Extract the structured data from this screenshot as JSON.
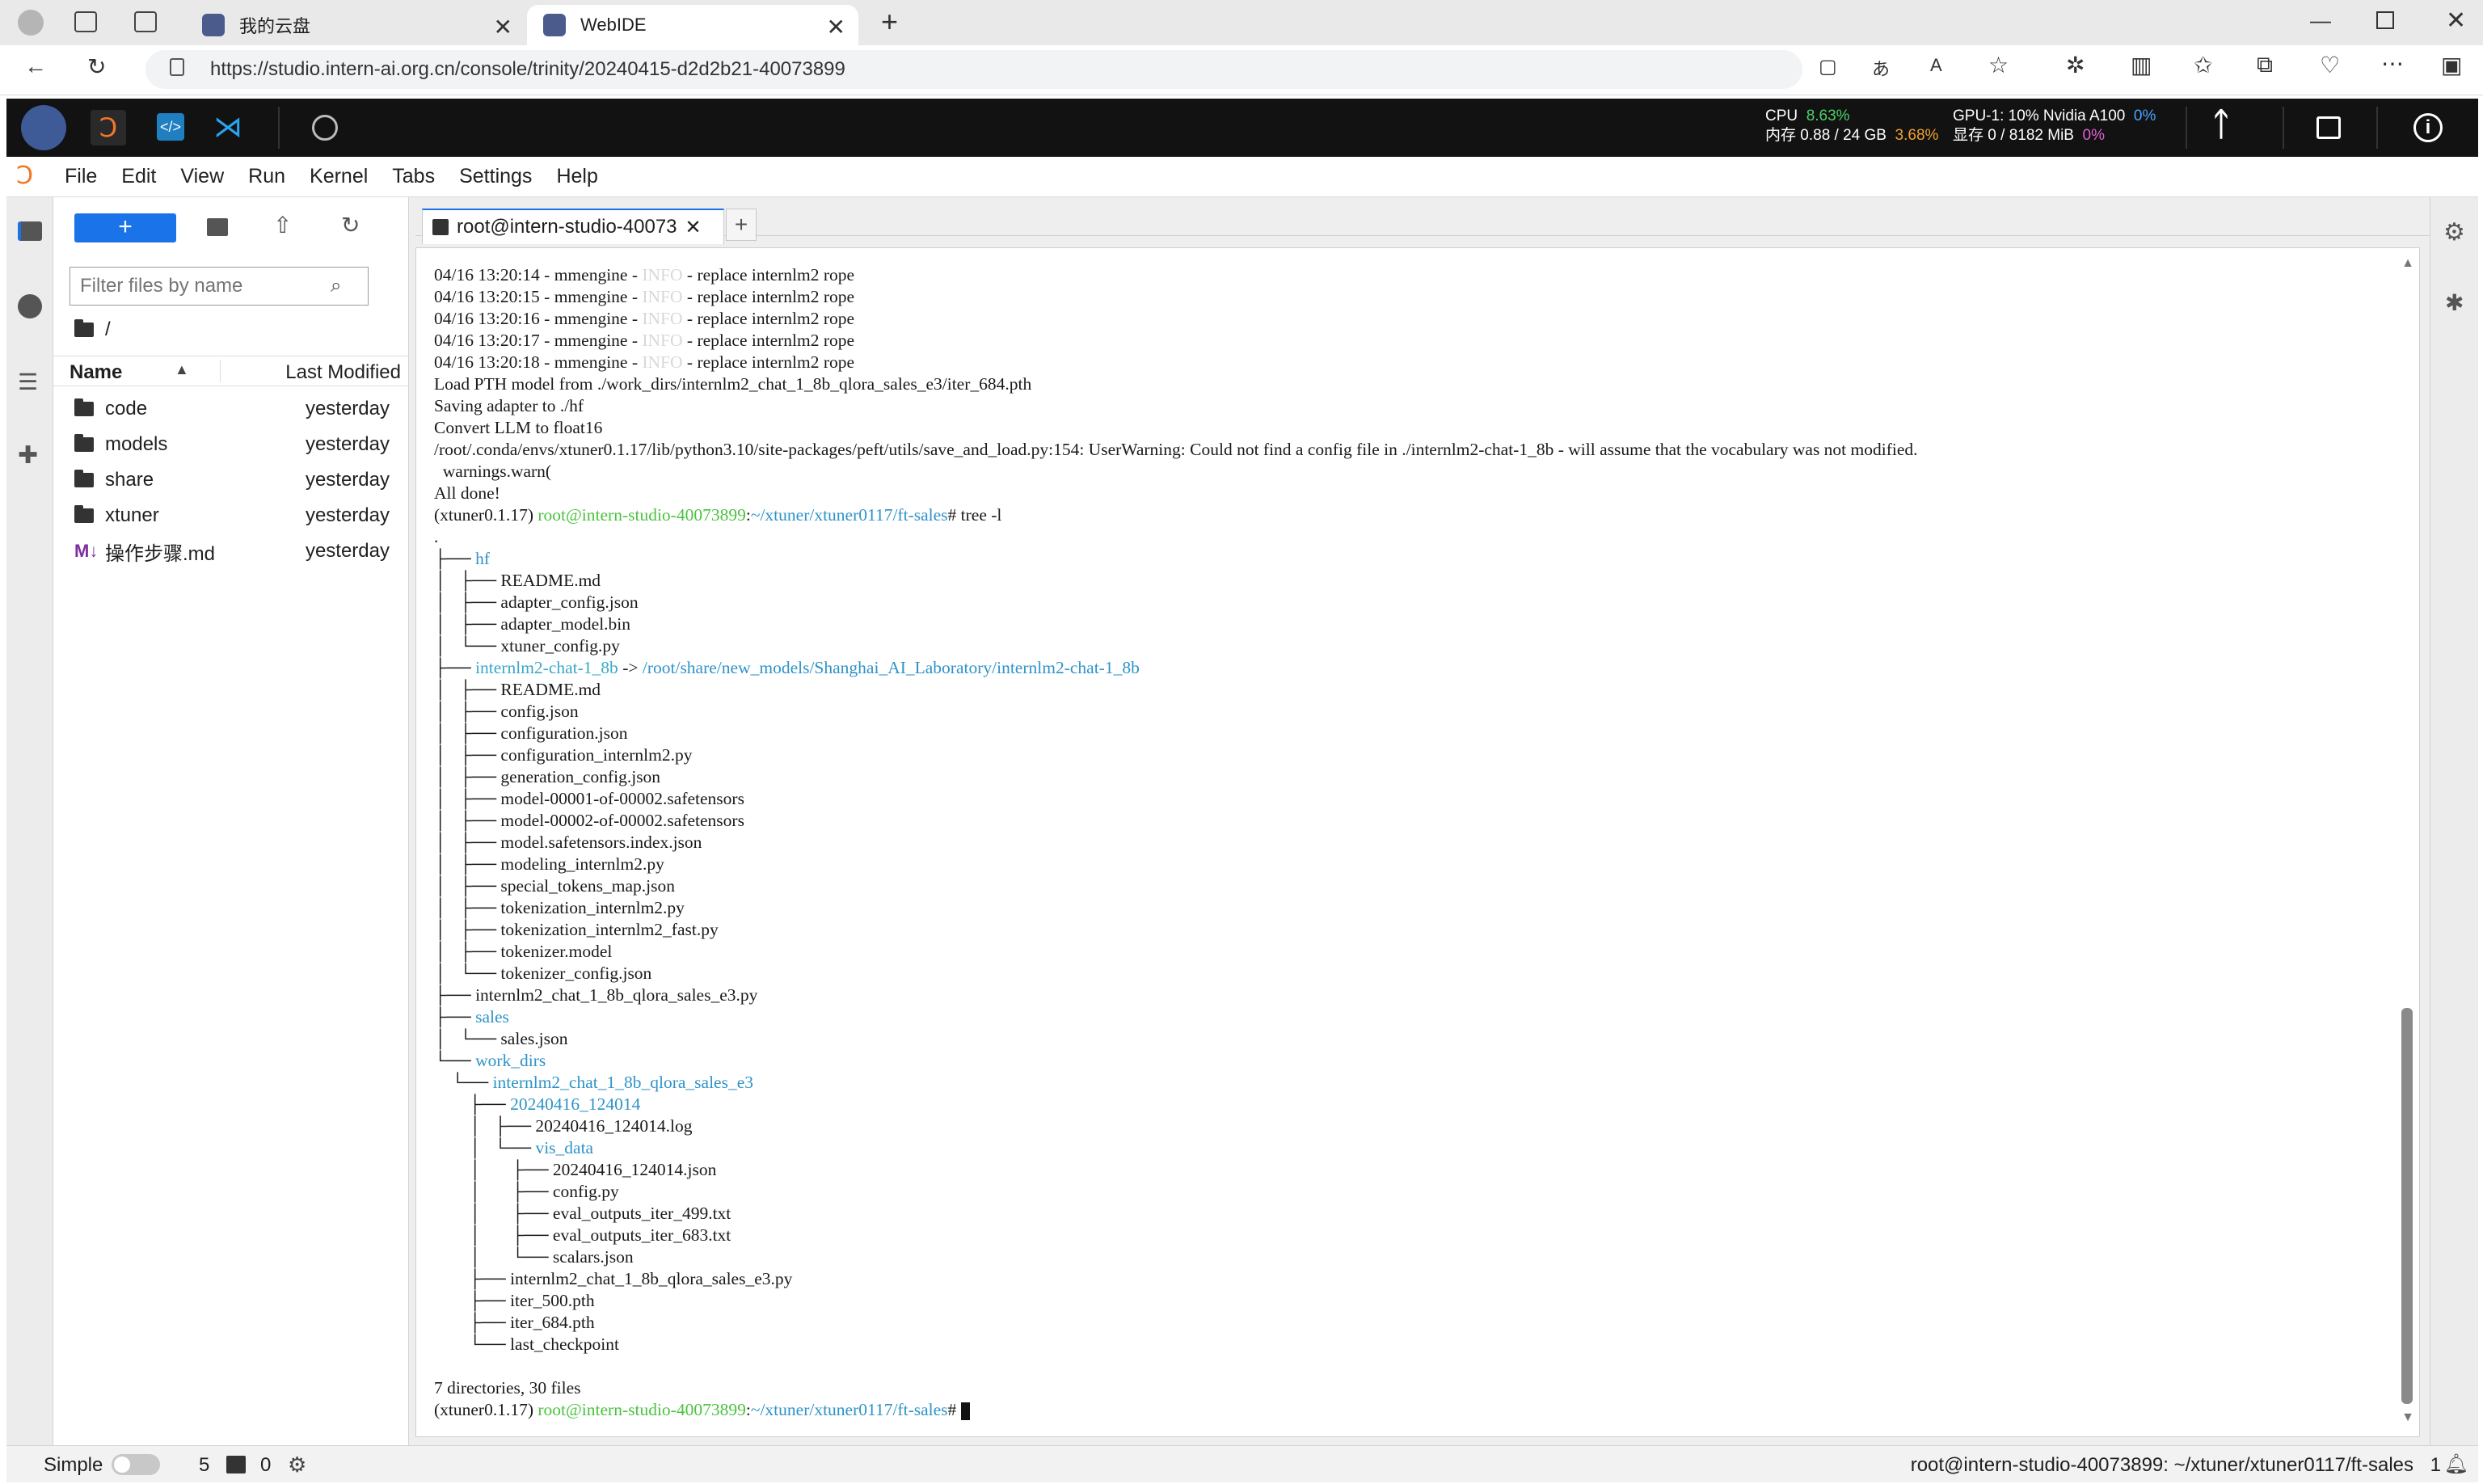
{
  "browser": {
    "tabs": [
      {
        "title": "我的云盘"
      },
      {
        "title": "WebIDE"
      }
    ],
    "url": "https://studio.intern-ai.org.cn/console/trinity/20240415-d2d2b21-40073899"
  },
  "app_header": {
    "cpu_label": "CPU",
    "cpu_value": "8.63%",
    "mem_label": "内存",
    "mem_value": "0.88 / 24 GB",
    "mem_pct": "3.68%",
    "gpu_label": "GPU-1: 10% Nvidia A100",
    "gpu_pct": "0%",
    "vram_label": "显存",
    "vram_value": "0 / 8182 MiB",
    "vram_pct": "0%"
  },
  "menubar": [
    "File",
    "Edit",
    "View",
    "Run",
    "Kernel",
    "Tabs",
    "Settings",
    "Help"
  ],
  "filebrowser": {
    "new_button": "+",
    "filter_placeholder": "Filter files by name",
    "path": "/",
    "col_name": "Name",
    "col_modified": "Last Modified",
    "items": [
      {
        "name": "code",
        "modified": "yesterday",
        "type": "folder"
      },
      {
        "name": "models",
        "modified": "yesterday",
        "type": "folder"
      },
      {
        "name": "share",
        "modified": "yesterday",
        "type": "folder"
      },
      {
        "name": "xtuner",
        "modified": "yesterday",
        "type": "folder"
      },
      {
        "name": "操作步骤.md",
        "modified": "yesterday",
        "type": "markdown"
      }
    ]
  },
  "terminal": {
    "tab_title": "root@intern-studio-40073",
    "lines": [
      [
        {
          "t": "04/16 13:20:14 - mmengine - "
        },
        {
          "t": "INFO",
          "c": "dim"
        },
        {
          "t": " - replace internlm2 rope"
        }
      ],
      [
        {
          "t": "04/16 13:20:15 - mmengine - "
        },
        {
          "t": "INFO",
          "c": "dim"
        },
        {
          "t": " - replace internlm2 rope"
        }
      ],
      [
        {
          "t": "04/16 13:20:16 - mmengine - "
        },
        {
          "t": "INFO",
          "c": "dim"
        },
        {
          "t": " - replace internlm2 rope"
        }
      ],
      [
        {
          "t": "04/16 13:20:17 - mmengine - "
        },
        {
          "t": "INFO",
          "c": "dim"
        },
        {
          "t": " - replace internlm2 rope"
        }
      ],
      [
        {
          "t": "04/16 13:20:18 - mmengine - "
        },
        {
          "t": "INFO",
          "c": "dim"
        },
        {
          "t": " - replace internlm2 rope"
        }
      ],
      [
        {
          "t": "Load PTH model from ./work_dirs/internlm2_chat_1_8b_qlora_sales_e3/iter_684.pth"
        }
      ],
      [
        {
          "t": "Saving adapter to ./hf"
        }
      ],
      [
        {
          "t": "Convert LLM to float16"
        }
      ],
      [
        {
          "t": "/root/.conda/envs/xtuner0.1.17/lib/python3.10/site-packages/peft/utils/save_and_load.py:154: UserWarning: Could not find a config file in ./internlm2-chat-1_8b - will assume that the vocabulary was not modified."
        }
      ],
      [
        {
          "t": "  warnings.warn("
        }
      ],
      [
        {
          "t": "All done!"
        }
      ],
      [
        {
          "t": "(xtuner0.1.17) "
        },
        {
          "t": "root@intern-studio-40073899",
          "c": "green"
        },
        {
          "t": ":"
        },
        {
          "t": "~/xtuner/xtuner0117/ft-sales",
          "c": "blue"
        },
        {
          "t": "# tree -l"
        }
      ],
      [
        {
          "t": "."
        }
      ],
      [
        {
          "t": "├── "
        },
        {
          "t": "hf",
          "c": "blue"
        }
      ],
      [
        {
          "t": "│   ├── README.md"
        }
      ],
      [
        {
          "t": "│   ├── adapter_config.json"
        }
      ],
      [
        {
          "t": "│   ├── adapter_model.bin"
        }
      ],
      [
        {
          "t": "│   └── xtuner_config.py"
        }
      ],
      [
        {
          "t": "├── "
        },
        {
          "t": "internlm2-chat-1_8b",
          "c": "cyan"
        },
        {
          "t": " -> "
        },
        {
          "t": "/root/share/new_models/Shanghai_AI_Laboratory/internlm2-chat-1_8b",
          "c": "blue"
        }
      ],
      [
        {
          "t": "│   ├── README.md"
        }
      ],
      [
        {
          "t": "│   ├── config.json"
        }
      ],
      [
        {
          "t": "│   ├── configuration.json"
        }
      ],
      [
        {
          "t": "│   ├── configuration_internlm2.py"
        }
      ],
      [
        {
          "t": "│   ├── generation_config.json"
        }
      ],
      [
        {
          "t": "│   ├── model-00001-of-00002.safetensors"
        }
      ],
      [
        {
          "t": "│   ├── model-00002-of-00002.safetensors"
        }
      ],
      [
        {
          "t": "│   ├── model.safetensors.index.json"
        }
      ],
      [
        {
          "t": "│   ├── modeling_internlm2.py"
        }
      ],
      [
        {
          "t": "│   ├── special_tokens_map.json"
        }
      ],
      [
        {
          "t": "│   ├── tokenization_internlm2.py"
        }
      ],
      [
        {
          "t": "│   ├── tokenization_internlm2_fast.py"
        }
      ],
      [
        {
          "t": "│   ├── tokenizer.model"
        }
      ],
      [
        {
          "t": "│   └── tokenizer_config.json"
        }
      ],
      [
        {
          "t": "├── internlm2_chat_1_8b_qlora_sales_e3.py"
        }
      ],
      [
        {
          "t": "├── "
        },
        {
          "t": "sales",
          "c": "blue"
        }
      ],
      [
        {
          "t": "│   └── sales.json"
        }
      ],
      [
        {
          "t": "└── "
        },
        {
          "t": "work_dirs",
          "c": "blue"
        }
      ],
      [
        {
          "t": "    └── "
        },
        {
          "t": "internlm2_chat_1_8b_qlora_sales_e3",
          "c": "blue"
        }
      ],
      [
        {
          "t": "        ├── "
        },
        {
          "t": "20240416_124014",
          "c": "blue"
        }
      ],
      [
        {
          "t": "        │   ├── 20240416_124014.log"
        }
      ],
      [
        {
          "t": "        │   └── "
        },
        {
          "t": "vis_data",
          "c": "blue"
        }
      ],
      [
        {
          "t": "        │       ├── 20240416_124014.json"
        }
      ],
      [
        {
          "t": "        │       ├── config.py"
        }
      ],
      [
        {
          "t": "        │       ├── eval_outputs_iter_499.txt"
        }
      ],
      [
        {
          "t": "        │       ├── eval_outputs_iter_683.txt"
        }
      ],
      [
        {
          "t": "        │       └── scalars.json"
        }
      ],
      [
        {
          "t": "        ├── internlm2_chat_1_8b_qlora_sales_e3.py"
        }
      ],
      [
        {
          "t": "        ├── iter_500.pth"
        }
      ],
      [
        {
          "t": "        ├── iter_684.pth"
        }
      ],
      [
        {
          "t": "        └── last_checkpoint"
        }
      ],
      [
        {
          "t": ""
        }
      ],
      [
        {
          "t": "7 directories, 30 files"
        }
      ],
      [
        {
          "t": "(xtuner0.1.17) "
        },
        {
          "t": "root@intern-studio-40073899",
          "c": "green"
        },
        {
          "t": ":"
        },
        {
          "t": "~/xtuner/xtuner0117/ft-sales",
          "c": "blue"
        },
        {
          "t": "# "
        }
      ]
    ]
  },
  "statusbar": {
    "mode_label": "Simple",
    "count_a": "5",
    "count_b": "0",
    "right_text": "root@intern-studio-40073899: ~/xtuner/xtuner0117/ft-sales",
    "right_count": "1"
  },
  "colors": {
    "accent": "#1a73e8",
    "dark_header": "#121212",
    "prompt_green": "#4bc23f",
    "dir_blue": "#2f93c8"
  }
}
